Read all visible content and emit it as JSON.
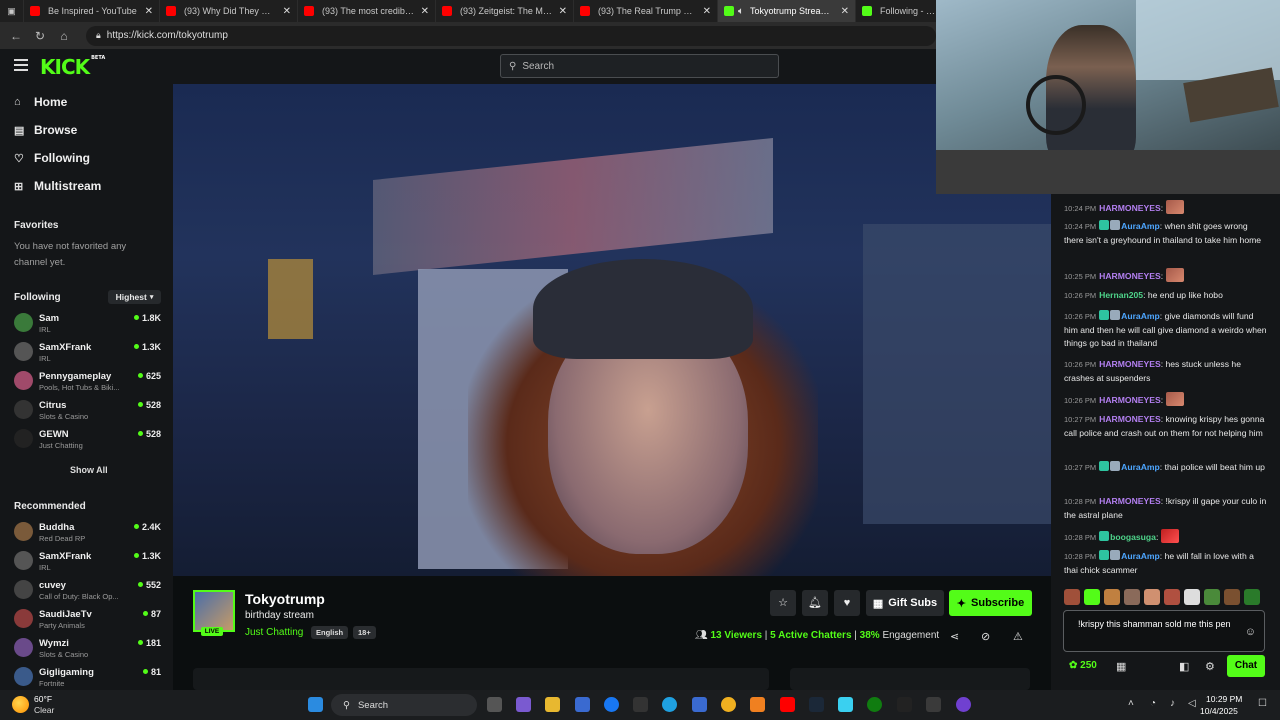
{
  "browser": {
    "tabs": [
      {
        "title": "Be Inspired - YouTube",
        "color": "#ff0000",
        "active": false
      },
      {
        "title": "(93) Why Did They Cut Down",
        "color": "#ff0000",
        "active": false
      },
      {
        "title": "(93) The most credible case",
        "color": "#ff0000",
        "active": false
      },
      {
        "title": "(93) Zeitgeist: The Movie (2",
        "color": "#ff0000",
        "active": false
      },
      {
        "title": "(93) The Real Trump Prophe",
        "color": "#ff0000",
        "active": false
      },
      {
        "title": "Tokyotrump Stream - Y",
        "color": "#53fc18",
        "active": true
      },
      {
        "title": "Following - Live",
        "color": "#53fc18",
        "active": false
      }
    ],
    "url": "https://kick.com/tokyotrump"
  },
  "header": {
    "logo": "KICK",
    "logo_sup": "BETA",
    "search_placeholder": "Search"
  },
  "sidebar": {
    "nav": [
      {
        "label": "Home",
        "icon": "home-icon"
      },
      {
        "label": "Browse",
        "icon": "browse-icon"
      },
      {
        "label": "Following",
        "icon": "heart-icon"
      },
      {
        "label": "Multistream",
        "icon": "grid-icon"
      }
    ],
    "favorites_heading": "Favorites",
    "favorites_empty": "You have not favorited any channel yet.",
    "following_heading": "Following",
    "sort_label": "Highest",
    "following": [
      {
        "name": "Sam",
        "category": "IRL",
        "viewers": "1.8K",
        "color": "#3a7a3a"
      },
      {
        "name": "SamXFrank",
        "category": "IRL",
        "viewers": "1.3K",
        "color": "#555"
      },
      {
        "name": "Pennygameplay",
        "category": "Pools, Hot Tubs & Biki...",
        "viewers": "625",
        "color": "#a04a6a"
      },
      {
        "name": "Citrus",
        "category": "Slots & Casino",
        "viewers": "528",
        "color": "#333"
      },
      {
        "name": "GEWN",
        "category": "Just Chatting",
        "viewers": "528",
        "color": "#222"
      }
    ],
    "show_all": "Show All",
    "recommended_heading": "Recommended",
    "recommended": [
      {
        "name": "Buddha",
        "category": "Red Dead RP",
        "viewers": "2.4K",
        "color": "#7a5a3a"
      },
      {
        "name": "SamXFrank",
        "category": "IRL",
        "viewers": "1.3K",
        "color": "#555"
      },
      {
        "name": "cuvey",
        "category": "Call of Duty: Black Op...",
        "viewers": "552",
        "color": "#444"
      },
      {
        "name": "SaudiJaeTv",
        "category": "Party Animals",
        "viewers": "87",
        "color": "#8a3a3a"
      },
      {
        "name": "Wymzi",
        "category": "Slots & Casino",
        "viewers": "181",
        "color": "#6a4a8a"
      },
      {
        "name": "Gigligaming",
        "category": "Fortnite",
        "viewers": "81",
        "color": "#3a5a8a"
      }
    ]
  },
  "stream": {
    "streamer": "Tokyotrump",
    "live_label": "LIVE",
    "title": "birthday stream",
    "category": "Just Chatting",
    "tags": [
      "English",
      "18+"
    ],
    "gift_label": "Gift Subs",
    "subscribe_label": "Subscribe",
    "viewers": "13 Viewers",
    "chatters": "5 Active Chatters",
    "engagement_pct": "38%",
    "engagement_label": "Engagement"
  },
  "chat": {
    "messages": [
      {
        "time": "10:24 PM",
        "user": "HARMONEYES",
        "color": "purple",
        "text": "",
        "emote": true,
        "badges": false
      },
      {
        "time": "10:24 PM",
        "user": "AuraAmp",
        "color": "blue",
        "text": ": when shit goes wrong there isn't a greyhound in thailand to take him home",
        "emote": false,
        "badges": true
      },
      {
        "time": "10:25 PM",
        "user": "HARMONEYES",
        "color": "purple",
        "text": "",
        "emote": true,
        "badges": false
      },
      {
        "time": "10:26 PM",
        "user": "Hernan205",
        "color": "green",
        "text": ": he end up like hobo",
        "emote": false,
        "badges": false
      },
      {
        "time": "10:26 PM",
        "user": "AuraAmp",
        "color": "blue",
        "text": ": give diamonds will fund him and then he will call give diamond a weirdo when things go bad in thailand",
        "emote": false,
        "badges": true
      },
      {
        "time": "10:26 PM",
        "user": "HARMONEYES",
        "color": "purple",
        "text": ": hes stuck unless he crashes at suspenders",
        "emote": false,
        "badges": false
      },
      {
        "time": "10:26 PM",
        "user": "HARMONEYES",
        "color": "purple",
        "text": "",
        "emote": true,
        "badges": false
      },
      {
        "time": "10:27 PM",
        "user": "HARMONEYES",
        "color": "purple",
        "text": ": knowing krispy hes gonna call police and crash out on them for not helping him",
        "emote": false,
        "badges": false
      },
      {
        "time": "10:27 PM",
        "user": "AuraAmp",
        "color": "blue",
        "text": ": thai police will beat him up",
        "emote": false,
        "badges": true
      },
      {
        "time": "10:28 PM",
        "user": "HARMONEYES",
        "color": "purple",
        "text": ": !krispy ill gape your culo in the astral plane",
        "emote": false,
        "badges": false
      },
      {
        "time": "10:28 PM",
        "user": "boogasuga",
        "color": "green",
        "text": "",
        "emote": true,
        "badges": true
      },
      {
        "time": "10:28 PM",
        "user": "AuraAmp",
        "color": "blue",
        "text": ": he will fall in love with a thai chick scammer",
        "emote": false,
        "badges": true
      }
    ],
    "input_text": "!krispy this shamman sold me this pen",
    "points": "250",
    "send_label": "Chat"
  },
  "taskbar": {
    "temp": "60°F",
    "weather": "Clear",
    "search": "Search",
    "time": "10:29 PM",
    "date": "10/4/2025"
  }
}
